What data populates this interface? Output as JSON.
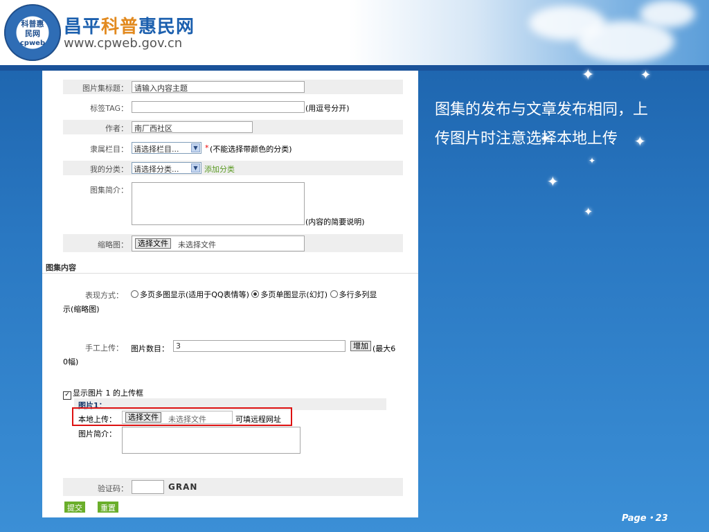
{
  "site": {
    "name_part1": "昌平",
    "name_part2": "科普",
    "name_part3": "惠民网",
    "url": "www.cpweb.gov.cn",
    "logo_text": "科普惠民网",
    "logo_sub": "cpweb"
  },
  "note": "图集的发布与文章发布相同，上传图片时注意选择本地上传",
  "page_label": "Page・23",
  "form": {
    "title_label": "图片集标题：",
    "title_value": "请输入内容主题",
    "tag_label": "标签TAG：",
    "tag_value": "",
    "tag_hint": "(用逗号分开)",
    "author_label": "作者：",
    "author_value": "南厂西社区",
    "column_label": "隶属栏目：",
    "column_value": "请选择栏目...",
    "column_hint_star": "*",
    "column_hint": "(不能选择带颜色的分类)",
    "category_label": "我的分类：",
    "category_value": "请选择分类...",
    "add_category": "添加分类",
    "intro_label": "图集简介：",
    "intro_hint": "(内容的简要说明)",
    "thumb_label": "缩略图：",
    "thumb_button": "选择文件",
    "thumb_status": "未选择文件",
    "section_title": "图集内容",
    "mode_label": "表现方式：",
    "mode_opt1": "多页多图显示(适用于QQ表情等)",
    "mode_opt2": "多页单图显示(幻灯)",
    "mode_opt3": "多行多列显",
    "mode_opt3_cont": "示(缩略图)",
    "manual_label": "手工上传：",
    "count_label": "图片数目：",
    "count_value": "3",
    "add_button": "增加",
    "max_hint": "(最大6",
    "max_hint_cont": "0幅)",
    "show_check": "显示图片 1 的上传框",
    "pic_title": "图片1：",
    "local_label": "本地上传：",
    "local_button": "选择文件",
    "local_status": "未选择文件",
    "remote_hint": "可填远程网址",
    "pic_intro_label": "图片简介：",
    "captcha_label": "验证码：",
    "captcha_value": "",
    "captcha_image_text": "GRAN",
    "submit": "提交",
    "reset": "重置"
  }
}
